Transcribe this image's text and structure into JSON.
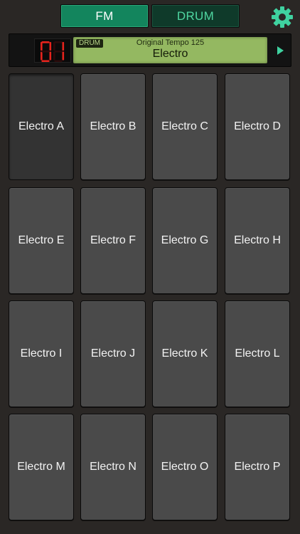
{
  "mode_tabs": [
    {
      "label": "FM",
      "selected": true
    },
    {
      "label": "DRUM",
      "selected": false
    }
  ],
  "settings_icon": "gear-icon",
  "header": {
    "kit_number": "01",
    "badge": "DRUM",
    "subtitle": "Original Tempo 125",
    "title": "Electro",
    "next_icon": "play-triangle-icon"
  },
  "pads": [
    "Electro A",
    "Electro B",
    "Electro C",
    "Electro D",
    "Electro E",
    "Electro F",
    "Electro G",
    "Electro H",
    "Electro I",
    "Electro J",
    "Electro K",
    "Electro L",
    "Electro M",
    "Electro N",
    "Electro O",
    "Electro P"
  ],
  "active_pad": 0,
  "colors": {
    "background": "#2a2725",
    "tab_fm": "#13855d",
    "tab_drum": "#0f3a2a",
    "drum_text": "#4fd6a1",
    "gear": "#3fd2a0",
    "lcd": "#94b861",
    "led_segment": "#e6231c",
    "pad": "#4a4a4a",
    "pad_active": "#333333"
  }
}
